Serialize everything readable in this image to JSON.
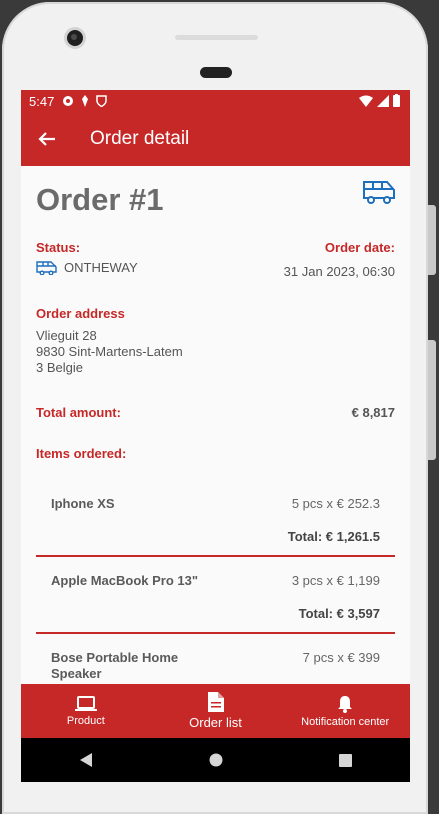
{
  "status_bar": {
    "time": "5:47"
  },
  "app_bar": {
    "title": "Order detail"
  },
  "order": {
    "title": "Order #1",
    "status_label": "Status:",
    "status_value": "ONTHEWAY",
    "date_label": "Order date:",
    "date_value": "31 Jan 2023, 06:30",
    "address_label": "Order address",
    "address_lines": [
      "Vlieguit 28",
      "9830 Sint-Martens-Latem",
      "3 Belgie"
    ],
    "total_label": "Total amount:",
    "total_value": "€ 8,817",
    "items_label": "Items ordered:"
  },
  "items": [
    {
      "name": "Iphone XS",
      "qty": "5 pcs x € 252.3",
      "total": "Total: € 1,261.5"
    },
    {
      "name": "Apple MacBook Pro 13\"",
      "qty": "3 pcs x € 1,199",
      "total": "Total: € 3,597"
    },
    {
      "name": "Bose Portable Home Speaker",
      "qty": "7 pcs x € 399",
      "total": ""
    }
  ],
  "bottom_nav": [
    {
      "label": "Product",
      "icon": "laptop-icon"
    },
    {
      "label": "Order list",
      "icon": "document-icon"
    },
    {
      "label": "Notification center",
      "icon": "bell-icon"
    }
  ],
  "colors": {
    "primary": "#c62828",
    "accent_blue": "#1e6fbd"
  }
}
